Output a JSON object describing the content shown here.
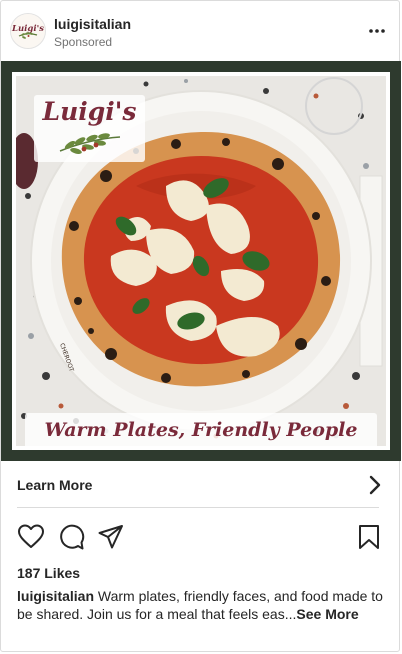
{
  "post": {
    "username": "luigisitalian",
    "sponsored_label": "Sponsored",
    "avatar_text": "Luigi's",
    "image": {
      "logo_text": "Luigi's",
      "tagline": "Warm Plates, Friendly People",
      "frame_color": "#2e3a2e",
      "brand_color": "#7a2a3a"
    },
    "cta": {
      "label": "Learn More",
      "icon": "chevron-right-icon"
    },
    "actions": [
      "heart-icon",
      "comment-icon",
      "share-icon",
      "bookmark-icon"
    ],
    "likes": "187 Likes",
    "caption": {
      "username": "luigisitalian",
      "text": "Warm plates, friendly faces, and food made to be shared. Join us for a meal that feels eas...",
      "see_more": "See More"
    }
  }
}
